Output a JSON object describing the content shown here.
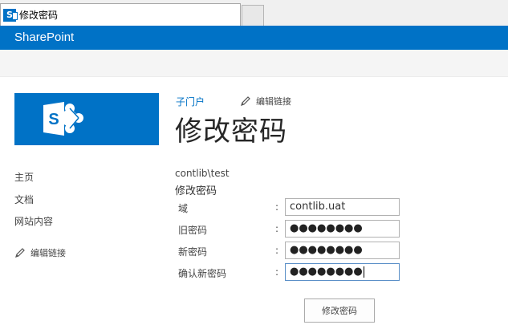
{
  "browser": {
    "tab_title": "修改密码"
  },
  "suitebar": {
    "title": "SharePoint"
  },
  "site": {
    "logo_icon": "sharepoint-logo-icon",
    "logo_letter": "S"
  },
  "left_nav": {
    "items": [
      {
        "label": "主页"
      },
      {
        "label": "文档"
      },
      {
        "label": "网站内容"
      }
    ],
    "edit_links": "编辑链接"
  },
  "header": {
    "breadcrumb": "子门户",
    "edit_links": "编辑链接",
    "page_title": "修改密码"
  },
  "form": {
    "user": "contlib\\test",
    "section_title": "修改密码",
    "colon": ":",
    "fields": [
      {
        "label": "域",
        "value": "contlib.uat"
      },
      {
        "label": "旧密码",
        "value": "●●●●●●●●"
      },
      {
        "label": "新密码",
        "value": "●●●●●●●●"
      },
      {
        "label": "确认新密码",
        "value": "●●●●●●●●"
      }
    ],
    "submit_label": "修改密码"
  },
  "colors": {
    "brand": "#0072c6",
    "link": "#0072c6"
  }
}
